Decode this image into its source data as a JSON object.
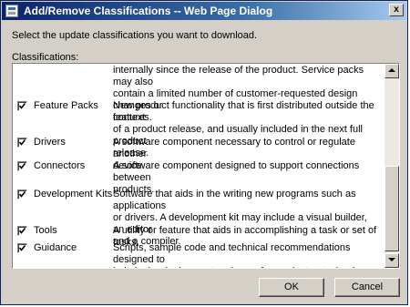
{
  "window": {
    "title": "Add/Remove Classifications -- Web Page Dialog",
    "close_glyph": "x"
  },
  "instruction": "Select the update classifications you want to download.",
  "classifications_label": "Classifications:",
  "partial_row": {
    "lines": [
      "internally since the release of the product. Service packs may also",
      "contain a limited number of customer-requested design changes or",
      "features."
    ]
  },
  "items": [
    {
      "name": "Feature Packs",
      "checked": true,
      "lines": [
        "New product functionality that is first distributed outside the context",
        "of a product release, and usually included in the next full product",
        "release."
      ]
    },
    {
      "name": "Drivers",
      "checked": true,
      "lines": [
        "A software component necessary to control or regulate another",
        "device."
      ]
    },
    {
      "name": "Connectors",
      "checked": true,
      "lines": [
        "A software component designed to support connections between",
        "products."
      ]
    },
    {
      "name": "Development Kits",
      "checked": true,
      "lines": [
        "Software that aids in the writing new programs such as applications",
        "or drivers. A development kit may include a visual builder, an editor",
        "and a compiler."
      ]
    },
    {
      "name": "Tools",
      "checked": true,
      "lines": [
        "A utility or feature that aids in accomplishing a task or set of tasks."
      ]
    },
    {
      "name": "Guidance",
      "checked": true,
      "lines": [
        "Scripts, sample code and technical recommendations designed to",
        "help in the deployment and use of a product or technology."
      ]
    }
  ],
  "buttons": {
    "ok": "OK",
    "cancel": "Cancel"
  }
}
